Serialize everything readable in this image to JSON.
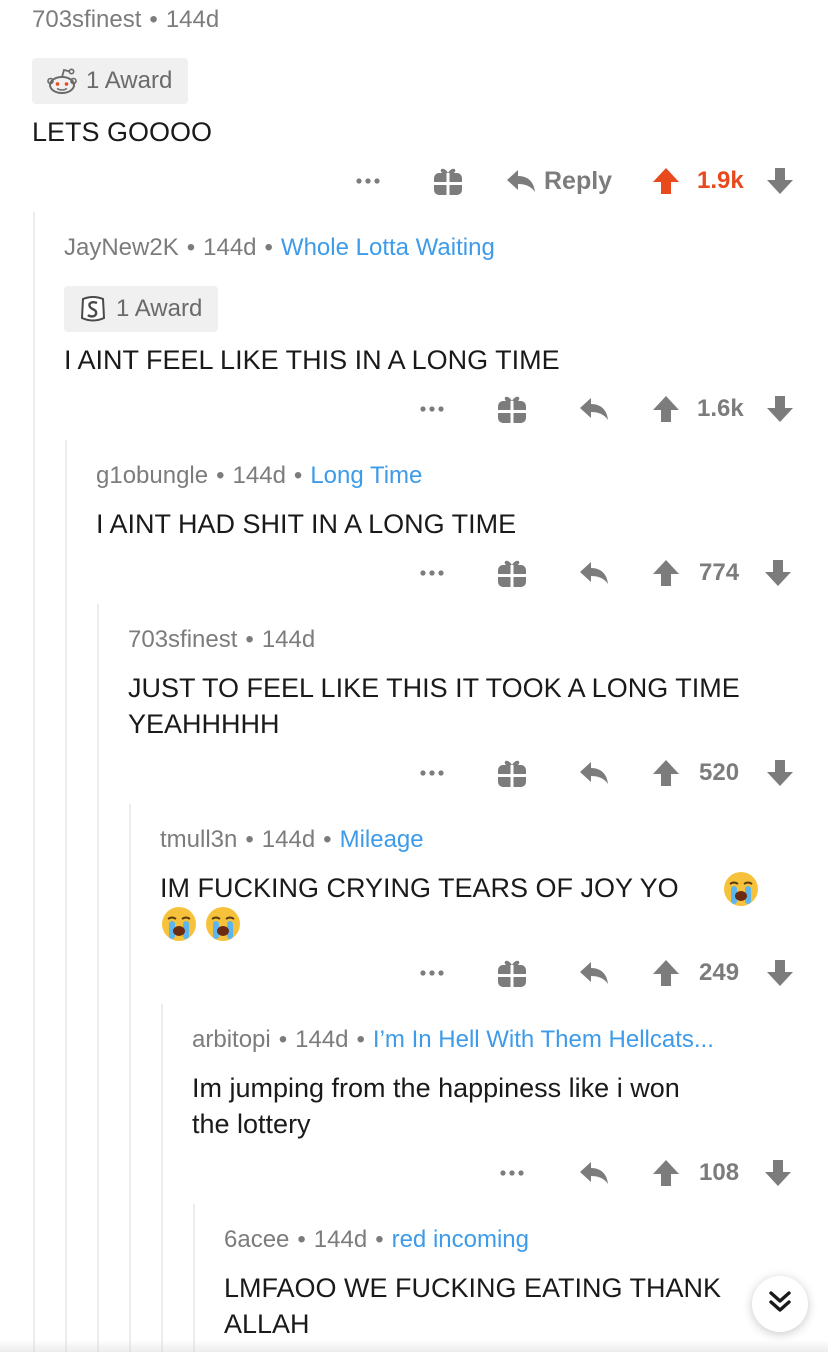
{
  "comments": [
    {
      "author": "703sfinest",
      "age": "144d",
      "flair": "",
      "award": "1 Award",
      "body": "LETS GOOOO",
      "reply_label": "Reply",
      "score": "1.9k"
    },
    {
      "author": "JayNew2K",
      "age": "144d",
      "flair": "Whole Lotta Waiting",
      "award": "1 Award",
      "body": "I AINT FEEL LIKE THIS IN A LONG TIME",
      "score": "1.6k"
    },
    {
      "author": "g1obungle",
      "age": "144d",
      "flair": "Long Time",
      "body": "I AINT HAD SHIT IN A LONG TIME",
      "score": "774"
    },
    {
      "author": "703sfinest",
      "age": "144d",
      "flair": "",
      "body_lines": [
        "JUST TO FEEL LIKE THIS IT TOOK A LONG TIME",
        "YEAHHHHH"
      ],
      "score": "520"
    },
    {
      "author": "tmull3n",
      "age": "144d",
      "flair": "Mileage",
      "body": "IM FUCKING CRYING TEARS OF JOY YO",
      "emoji": "loudly-crying-face",
      "score": "249"
    },
    {
      "author": "arbitopi",
      "age": "144d",
      "flair": "I’m In Hell With Them Hellcats...",
      "body_lines": [
        "Im jumping from the happiness like i won",
        "the lottery"
      ],
      "score": "108"
    },
    {
      "author": "6acee",
      "age": "144d",
      "flair": "red incoming",
      "body_lines": [
        "LMFAOO WE FUCKING EATING THANK",
        "ALLAH"
      ]
    }
  ],
  "colors": {
    "upvote_active": "#e8491d",
    "flair": "#3d9be9",
    "meta": "#7c7c7c",
    "thread_line": "#ededed",
    "award_bg": "#f0f0f0"
  },
  "icons": {
    "more": "more-options-icon",
    "gift": "gift-award-icon",
    "reply": "reply-arrow-icon",
    "upvote": "upvote-arrow-icon",
    "downvote": "downvote-arrow-icon",
    "scroll": "double-chevron-down-icon"
  }
}
